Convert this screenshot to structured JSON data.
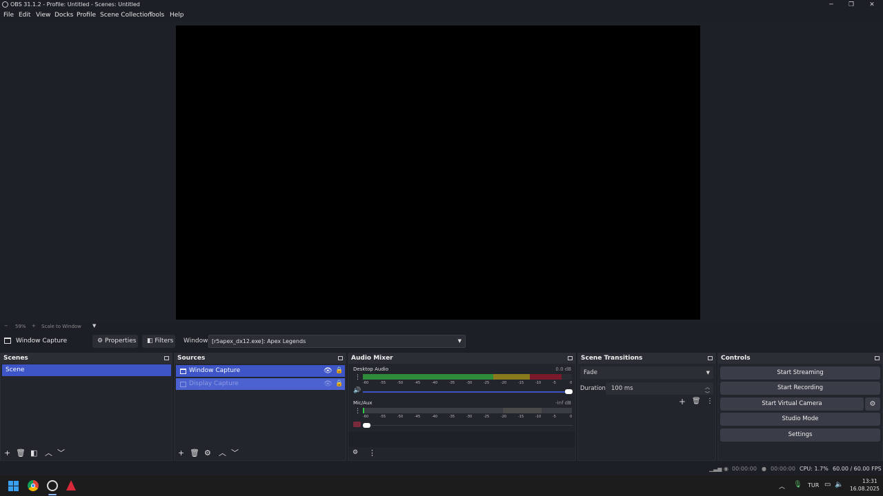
{
  "window": {
    "title": "OBS 31.1.2 - Profile: Untitled - Scenes: Untitled",
    "minimize": "─",
    "restore": "❐",
    "close": "✕"
  },
  "menu": [
    "File",
    "Edit",
    "View",
    "Docks",
    "Profile",
    "Scene Collection",
    "Tools",
    "Help"
  ],
  "zoom": {
    "minus": "−",
    "value": "59%",
    "plus": "+",
    "mode": "Scale to Window"
  },
  "source_toolbar": {
    "source_name": "Window Capture",
    "properties": "Properties",
    "filters": "Filters",
    "window_label": "Window",
    "window_value": "[r5apex_dx12.exe]: Apex Legends"
  },
  "scenes": {
    "title": "Scenes",
    "items": [
      "Scene"
    ]
  },
  "sources": {
    "title": "Sources",
    "items": [
      "Window Capture",
      "Display Capture"
    ]
  },
  "audio_mixer": {
    "title": "Audio Mixer",
    "channels": [
      {
        "name": "Desktop Audio",
        "db": "0.0 dB",
        "level": 0.95,
        "volume": 1.0
      },
      {
        "name": "Mic/Aux",
        "db": "-inf dB",
        "level": 0.0,
        "volume": 0.0
      }
    ],
    "scale": [
      "-60",
      "-55",
      "-50",
      "-45",
      "-40",
      "-35",
      "-30",
      "-25",
      "-20",
      "-15",
      "-10",
      "-5",
      "0"
    ]
  },
  "transitions": {
    "title": "Scene Transitions",
    "selected": "Fade",
    "duration_label": "Duration",
    "duration_value": "100 ms"
  },
  "controls": {
    "title": "Controls",
    "start_streaming": "Start Streaming",
    "start_recording": "Start Recording",
    "start_virtual_camera": "Start Virtual Camera",
    "studio_mode": "Studio Mode",
    "settings": "Settings"
  },
  "status": {
    "stream_time": "00:00:00",
    "record_time": "00:00:00",
    "cpu": "CPU: 1.7%",
    "fps": "60.00 / 60.00 FPS"
  },
  "taskbar": {
    "language": "TUR",
    "time": "13:31",
    "date": "16.08.2025"
  },
  "colors": {
    "accent": "#3e55c8",
    "meter_green": "#2e8b3a",
    "meter_yellow": "#8a7a1e",
    "meter_red": "#7a1a2a"
  }
}
